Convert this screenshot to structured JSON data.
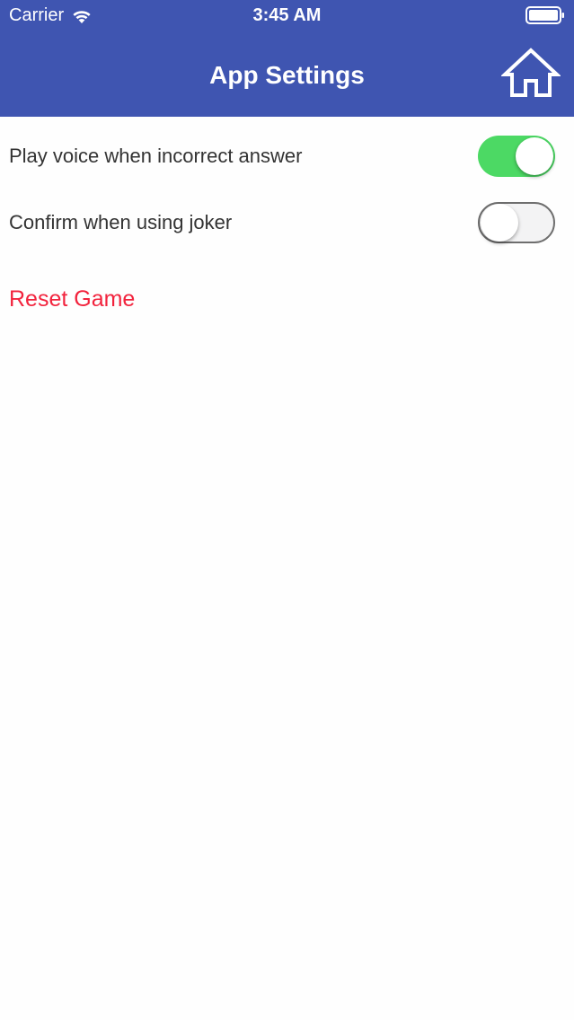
{
  "status_bar": {
    "carrier": "Carrier",
    "time": "3:45 AM",
    "wifi_icon": "wifi-icon",
    "battery_icon": "battery-icon"
  },
  "nav": {
    "title": "App Settings",
    "home_icon": "home-icon",
    "background_color": "#3f55b1"
  },
  "settings": [
    {
      "label": "Play voice when incorrect answer",
      "enabled": true
    },
    {
      "label": "Confirm when using joker",
      "enabled": false
    }
  ],
  "reset": {
    "label": "Reset Game",
    "color": "#f2233d"
  },
  "colors": {
    "toggle_on": "#4cd964"
  }
}
